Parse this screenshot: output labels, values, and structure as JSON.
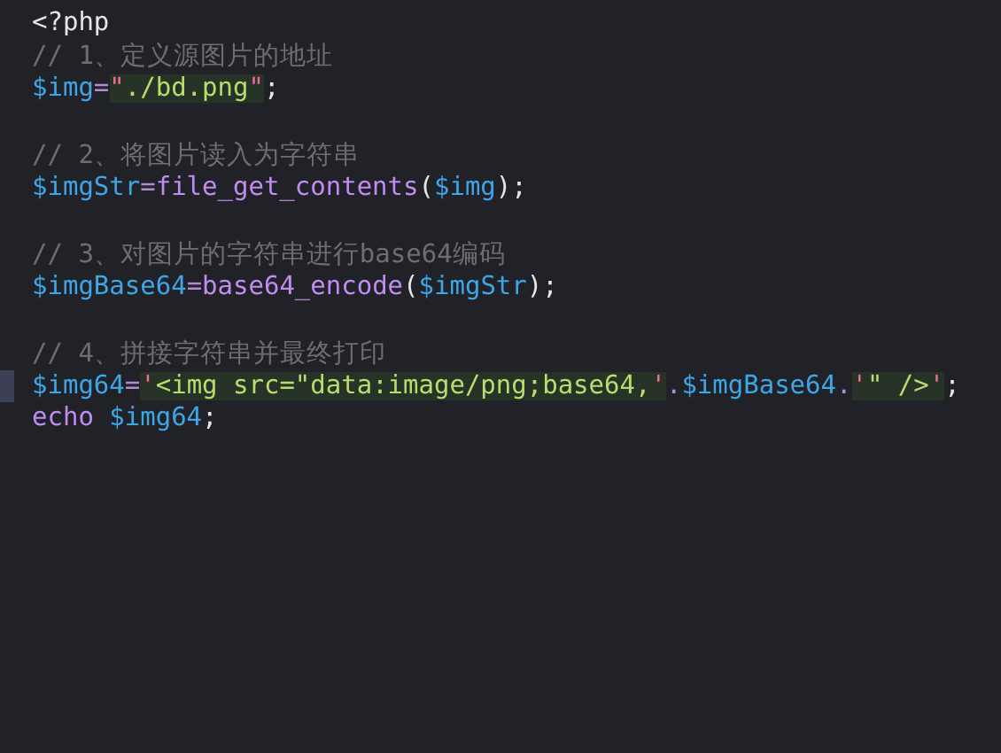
{
  "editor": {
    "lines": [
      {
        "kind": "code",
        "current": false,
        "tokens": [
          {
            "kind": "plain",
            "text": "<?php"
          }
        ]
      },
      {
        "kind": "code",
        "current": false,
        "tokens": [
          {
            "kind": "comment",
            "text": "// 1、定义源图片的地址"
          }
        ]
      },
      {
        "kind": "code",
        "current": false,
        "tokens": [
          {
            "kind": "variable",
            "text": "$img"
          },
          {
            "kind": "operator",
            "text": "="
          },
          {
            "kind": "quote",
            "text": "\""
          },
          {
            "kind": "string",
            "text": "./bd.png"
          },
          {
            "kind": "quote",
            "text": "\""
          },
          {
            "kind": "plain",
            "text": ";"
          }
        ]
      },
      {
        "kind": "blank"
      },
      {
        "kind": "code",
        "current": false,
        "tokens": [
          {
            "kind": "comment",
            "text": "// 2、将图片读入为字符串"
          }
        ]
      },
      {
        "kind": "code",
        "current": false,
        "tokens": [
          {
            "kind": "variable",
            "text": "$imgStr"
          },
          {
            "kind": "operator",
            "text": "="
          },
          {
            "kind": "function",
            "text": "file_get_contents"
          },
          {
            "kind": "plain",
            "text": "("
          },
          {
            "kind": "variable",
            "text": "$img"
          },
          {
            "kind": "plain",
            "text": ");"
          }
        ]
      },
      {
        "kind": "blank"
      },
      {
        "kind": "code",
        "current": false,
        "tokens": [
          {
            "kind": "comment",
            "text": "// 3、对图片的字符串进行base64编码"
          }
        ]
      },
      {
        "kind": "code",
        "current": false,
        "tokens": [
          {
            "kind": "variable",
            "text": "$imgBase64"
          },
          {
            "kind": "operator",
            "text": "="
          },
          {
            "kind": "function",
            "text": "base64_encode"
          },
          {
            "kind": "plain",
            "text": "("
          },
          {
            "kind": "variable",
            "text": "$imgStr"
          },
          {
            "kind": "plain",
            "text": ");"
          }
        ]
      },
      {
        "kind": "blank"
      },
      {
        "kind": "code",
        "current": false,
        "tokens": [
          {
            "kind": "comment",
            "text": "// 4、拼接字符串并最终打印"
          }
        ]
      },
      {
        "kind": "code",
        "current": true,
        "tokens": [
          {
            "kind": "variable",
            "text": "$img64"
          },
          {
            "kind": "operator",
            "text": "="
          },
          {
            "kind": "quote",
            "text": "'"
          },
          {
            "kind": "string",
            "text": "<img src=\"data:image/png;base64,"
          },
          {
            "kind": "quote",
            "text": "'"
          },
          {
            "kind": "operator",
            "text": "."
          },
          {
            "kind": "variable",
            "text": "$imgBase64"
          },
          {
            "kind": "operator",
            "text": "."
          },
          {
            "kind": "quote",
            "text": "'"
          },
          {
            "kind": "string",
            "text": "\" />"
          },
          {
            "kind": "quote",
            "text": "'"
          },
          {
            "kind": "plain",
            "text": ";"
          }
        ]
      },
      {
        "kind": "code",
        "current": false,
        "tokens": [
          {
            "kind": "function",
            "text": "echo "
          },
          {
            "kind": "variable",
            "text": "$img64"
          },
          {
            "kind": "plain",
            "text": ";"
          }
        ]
      }
    ]
  }
}
